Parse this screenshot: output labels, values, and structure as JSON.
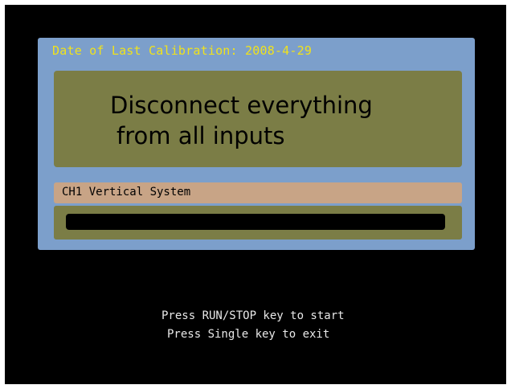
{
  "calibration": {
    "last_date_text": "Date of Last Calibration: 2008-4-29",
    "message_line1": "Disconnect everything",
    "message_line2": "from all inputs",
    "stage_label": "CH1 Vertical System",
    "progress": 0
  },
  "instructions": {
    "start_text": "Press RUN/STOP key to start",
    "exit_text": "Press Single key to exit"
  },
  "colors": {
    "panel": "#7c9fcb",
    "date_text": "#f0e21c",
    "message_box": "#7b7d46",
    "stage_label_bg": "#c8a486",
    "screen_bg": "#000000"
  }
}
